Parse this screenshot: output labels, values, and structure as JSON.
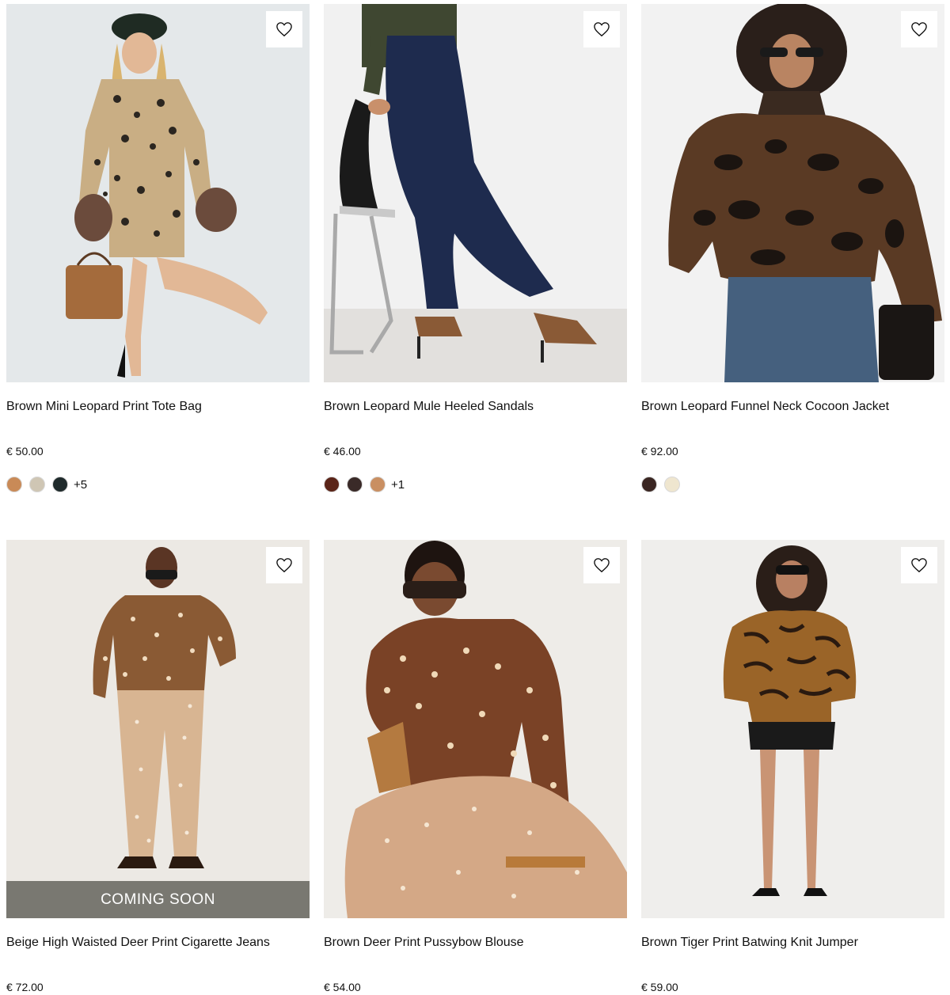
{
  "products": [
    {
      "name": "Brown Mini Leopard Print Tote Bag",
      "price": "€ 50.00",
      "swatches": [
        "#c98a57",
        "#cfc6b4",
        "#1f2a2b"
      ],
      "more": "+5",
      "coming_soon": ""
    },
    {
      "name": "Brown Leopard Mule Heeled Sandals",
      "price": "€ 46.00",
      "swatches": [
        "#5a2418",
        "#3a2a28",
        "#c98f62"
      ],
      "more": "+1",
      "coming_soon": ""
    },
    {
      "name": "Brown Leopard Funnel Neck Cocoon Jacket",
      "price": "€ 92.00",
      "swatches": [
        "#3a2622",
        "#efe6cf"
      ],
      "more": "",
      "coming_soon": ""
    },
    {
      "name": "Beige High Waisted Deer Print Cigarette Jeans",
      "price": "€ 72.00",
      "swatches": [],
      "more": "",
      "coming_soon": "COMING SOON"
    },
    {
      "name": "Brown Deer Print Pussybow Blouse",
      "price": "€ 54.00",
      "swatches": [],
      "more": "",
      "coming_soon": ""
    },
    {
      "name": "Brown Tiger Print Batwing Knit Jumper",
      "price": "€ 59.00",
      "swatches": [],
      "more": "",
      "coming_soon": ""
    }
  ],
  "icons": {
    "wishlist": "heart-outline-icon"
  }
}
